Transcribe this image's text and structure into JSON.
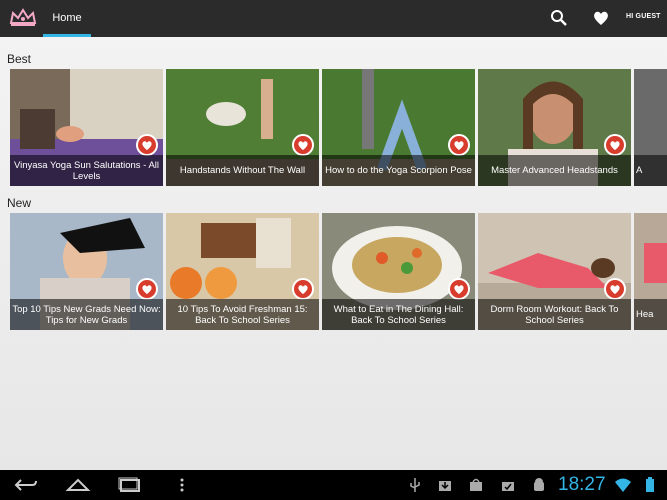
{
  "header": {
    "tab_home": "Home",
    "greeting": "HI GUEST",
    "icons": [
      "tiara-logo-icon",
      "search-icon",
      "heart-icon"
    ]
  },
  "sections": [
    {
      "title": "Best",
      "items": [
        {
          "title": "Vinyasa Yoga Sun Salutations - All Levels"
        },
        {
          "title": "Handstands Without The Wall"
        },
        {
          "title": "How to do the Yoga Scorpion Pose"
        },
        {
          "title": "Master Advanced Headstands"
        },
        {
          "title": "A"
        }
      ]
    },
    {
      "title": "New",
      "items": [
        {
          "title": "Top 10 Tips New Grads Need Now: Tips for New Grads"
        },
        {
          "title": "10 Tips To Avoid Freshman 15: Back To School Series"
        },
        {
          "title": "What to Eat in The Dining Hall: Back To School Series"
        },
        {
          "title": "Dorm Room Workout: Back To School Series"
        },
        {
          "title": "Hea"
        }
      ]
    }
  ],
  "status": {
    "time": "18:27"
  },
  "colors": {
    "accent": "#33b5e5",
    "heart": "#d73c2c",
    "actionbar": "#2b2b2b"
  }
}
